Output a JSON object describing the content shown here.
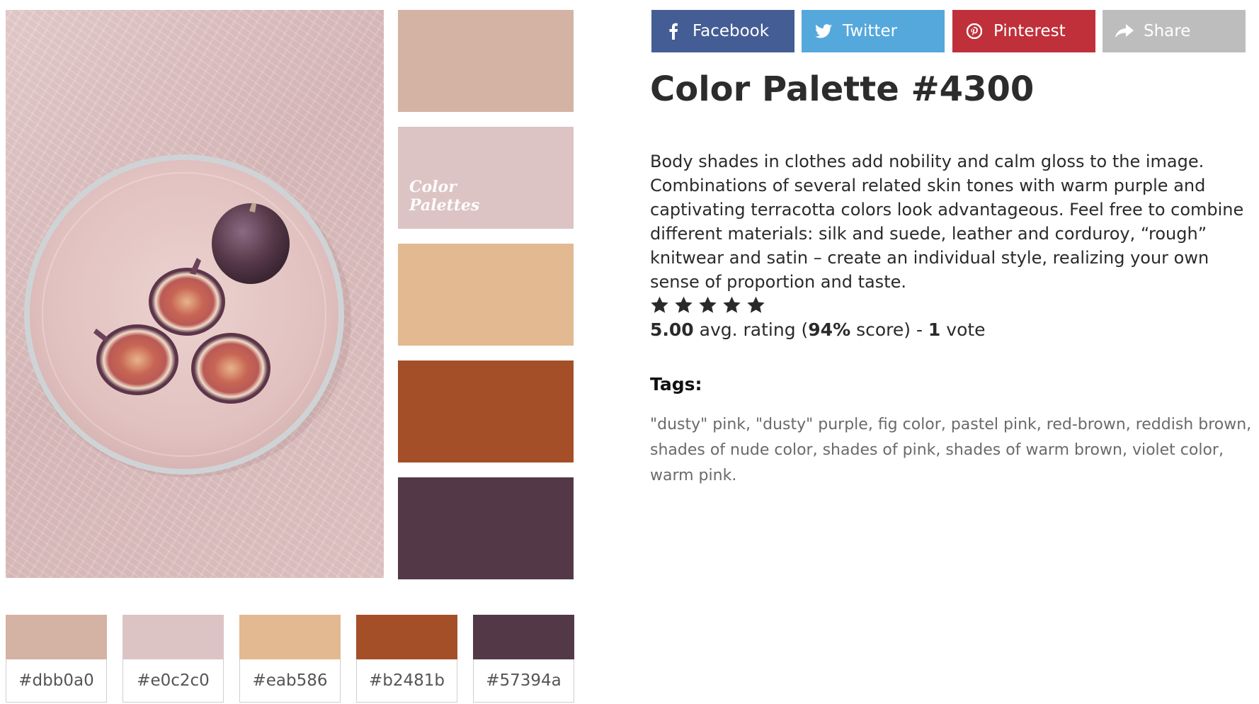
{
  "share": {
    "facebook": "Facebook",
    "twitter": "Twitter",
    "pinterest": "Pinterest",
    "share": "Share",
    "colors": {
      "facebook": "#3b5998",
      "twitter": "#55acee",
      "pinterest": "#cb2027",
      "share": "#b8b8b8"
    }
  },
  "watermark": {
    "line1": "Color",
    "line2": "Palettes"
  },
  "palette": {
    "title": "Color Palette #4300",
    "description": "Body shades in clothes add nobility and calm gloss to the image. Combinations of several related skin tones with warm purple and captivating terracotta colors look advantageous. Feel free to combine different materials: silk and suede, leather and corduroy, “rough” knitwear and satin – create an individual style, realizing your own sense of proportion and taste.",
    "swatches": [
      {
        "hex": "#dbb0a0",
        "label": "#dbb0a0"
      },
      {
        "hex": "#e0c2c0",
        "label": "#e0c2c0"
      },
      {
        "hex": "#eab586",
        "label": "#eab586"
      },
      {
        "hex": "#b2481b",
        "label": "#b2481b"
      },
      {
        "hex": "#57394a",
        "label": "#57394a"
      }
    ]
  },
  "rating": {
    "stars": 5,
    "average": "5.00",
    "avg_text": " avg. rating (",
    "score": "94%",
    "score_text": " score) - ",
    "votes": "1",
    "votes_text": " vote"
  },
  "tags": {
    "heading": "Tags:",
    "items": [
      "\"dusty\" pink",
      "\"dusty\" purple",
      "fig color",
      "pastel pink",
      "red-brown",
      "reddish brown",
      "shades of nude color",
      "shades of pink",
      "shades of warm brown",
      "violet color",
      "warm pink"
    ]
  }
}
